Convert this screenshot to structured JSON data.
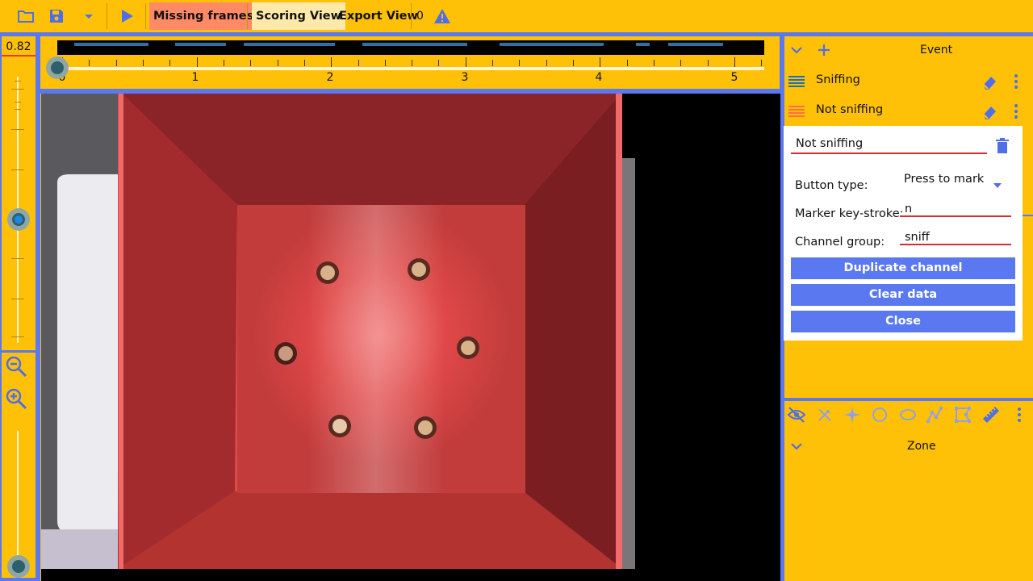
{
  "toolbar": {
    "icons": [
      "folder-open-icon",
      "save-icon",
      "dropdown-icon",
      "play-icon"
    ],
    "missing_frames_label": "Missing frames",
    "scoring_view_label": "Scoring View",
    "export_view_label": "Export View",
    "warning_count": "0",
    "warning_icon": "warning-icon"
  },
  "colors": {
    "background": "#ffc107",
    "accent": "#5a78f0",
    "missing_frames": "#ff8a65",
    "error_underline": "#d32f2f",
    "sniffing_channel": "#1e6fb3",
    "not_sniffing_channel": "#ff7043"
  },
  "zoom": {
    "value": "0.82",
    "zoom_level_fraction": 0.5,
    "zoom_out_icon": "zoom-out-icon",
    "zoom_in_icon": "zoom-in-icon"
  },
  "timeline": {
    "tick_labels": [
      "0",
      "1",
      "2",
      "3",
      "4",
      "5"
    ],
    "position_fraction": 0.0
  },
  "video": {
    "description_icon": "video-frame"
  },
  "panel": {
    "event_header": "Event",
    "channels": [
      {
        "label": "Sniffing",
        "icon": "lines-icon"
      },
      {
        "label": "Not sniffing",
        "icon": "lines-icon"
      }
    ],
    "editor": {
      "name_value": "Not sniffing",
      "button_type_label": "Button type:",
      "button_type_value": "Press to mark",
      "marker_label": "Marker key-stroke:",
      "marker_value": "n",
      "channel_group_label": "Channel group:",
      "channel_group_value": "sniff",
      "duplicate_label": "Duplicate channel",
      "clear_label": "Clear data",
      "close_label": "Close"
    },
    "zone_header": "Zone"
  }
}
